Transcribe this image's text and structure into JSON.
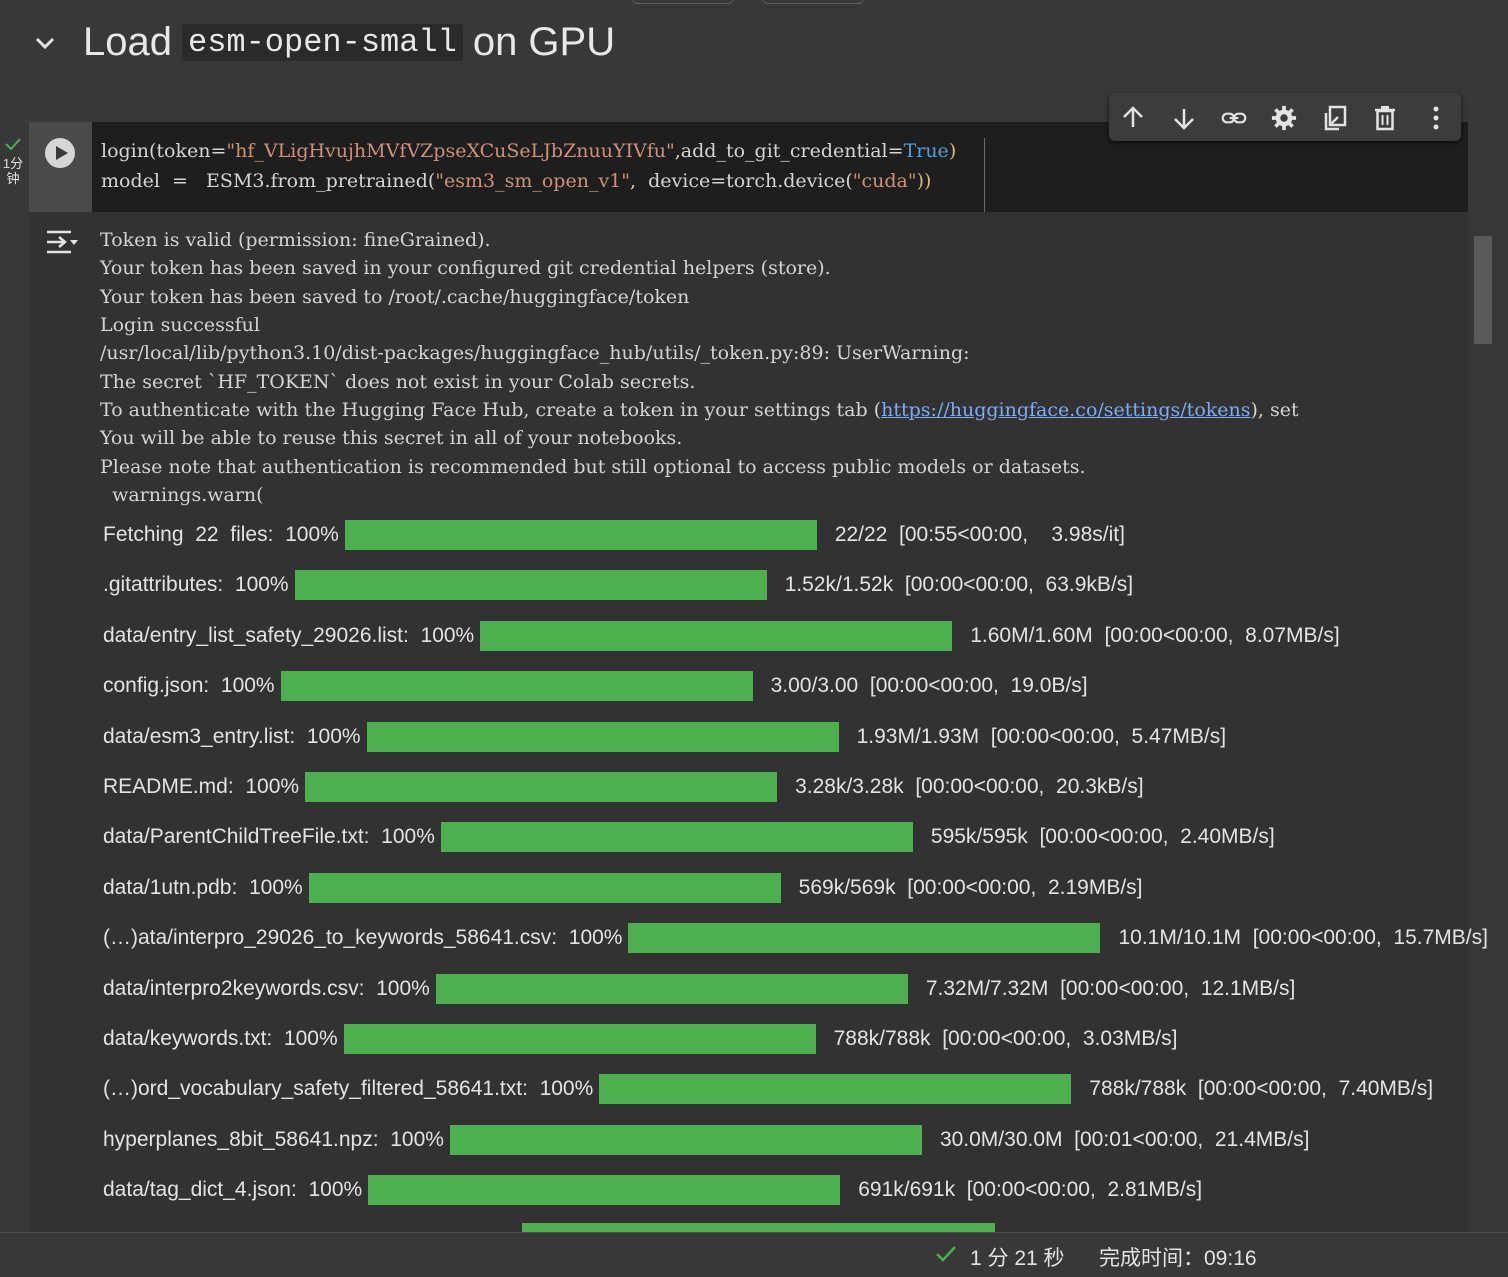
{
  "section": {
    "title_prefix": "Load",
    "title_code": "esm-open-small",
    "title_suffix": "on GPU"
  },
  "cell_status": {
    "time_line1": "1分",
    "time_line2": "钟"
  },
  "code": {
    "line1": {
      "a": "login(token=",
      "b": "\"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\"",
      "c": ",add_to_git_credential=",
      "d": "True",
      "e": ")"
    },
    "line2": {
      "a": "model  =   ESM3.from_pretrained(",
      "b": "\"esm3_sm_open_v1\"",
      "c": ",  device=torch.device(",
      "d": "\"cuda\"",
      "e": "))"
    }
  },
  "toolbar": {
    "icons": [
      "arrow-up-icon",
      "arrow-down-icon",
      "link-icon",
      "gear-icon",
      "mirror-cell-icon",
      "trash-icon",
      "more-vert-icon"
    ]
  },
  "output": {
    "lines": [
      "Token is valid (permission: fineGrained).",
      "Your token has been saved in your configured git credential helpers (store).",
      "Your token has been saved to /root/.cache/huggingface/token",
      "Login successful",
      "/usr/local/lib/python3.10/dist-packages/huggingface_hub/utils/_token.py:89: UserWarning:",
      "The secret `HF_TOKEN` does not exist in your Colab secrets.",
      "To authenticate with the Hugging Face Hub, create a token in your settings tab (",
      "You will be able to reuse this secret in all of your notebooks.",
      "Please note that authentication is recommended but still optional to access public models or datasets.",
      "  warnings.warn("
    ],
    "link_text": "https://huggingface.co/settings/tokens",
    "link_suffix": "), set"
  },
  "progress": [
    {
      "label": "Fetching  22  files:  100%",
      "stats": "22/22  [00:55<00:00,    3.98s/it]",
      "fraction": 1.0
    },
    {
      "label": ".gitattributes:  100%",
      "stats": "1.52k/1.52k  [00:00<00:00,  63.9kB/s]",
      "fraction": 1.0
    },
    {
      "label": "data/entry_list_safety_29026.list:  100%",
      "stats": "1.60M/1.60M  [00:00<00:00,  8.07MB/s]",
      "fraction": 1.0
    },
    {
      "label": "config.json:  100%",
      "stats": "3.00/3.00  [00:00<00:00,  19.0B/s]",
      "fraction": 1.0
    },
    {
      "label": "data/esm3_entry.list:  100%",
      "stats": "1.93M/1.93M  [00:00<00:00,  5.47MB/s]",
      "fraction": 1.0
    },
    {
      "label": "README.md:  100%",
      "stats": "3.28k/3.28k  [00:00<00:00,  20.3kB/s]",
      "fraction": 1.0
    },
    {
      "label": "data/ParentChildTreeFile.txt:  100%",
      "stats": "595k/595k  [00:00<00:00,  2.40MB/s]",
      "fraction": 1.0
    },
    {
      "label": "data/1utn.pdb:  100%",
      "stats": "569k/569k  [00:00<00:00,  2.19MB/s]",
      "fraction": 1.0
    },
    {
      "label": "(…)ata/interpro_29026_to_keywords_58641.csv:  100%",
      "stats": "10.1M/10.1M  [00:00<00:00,  15.7MB/s]",
      "fraction": 1.0
    },
    {
      "label": "data/interpro2keywords.csv:  100%",
      "stats": "7.32M/7.32M  [00:00<00:00,  12.1MB/s]",
      "fraction": 1.0
    },
    {
      "label": "data/keywords.txt:  100%",
      "stats": "788k/788k  [00:00<00:00,  3.03MB/s]",
      "fraction": 1.0
    },
    {
      "label": "(…)ord_vocabulary_safety_filtered_58641.txt:  100%",
      "stats": "788k/788k  [00:00<00:00,  7.40MB/s]",
      "fraction": 1.0
    },
    {
      "label": "hyperplanes_8bit_58641.npz:  100%",
      "stats": "30.0M/30.0M  [00:01<00:00,  21.4MB/s]",
      "fraction": 1.0
    },
    {
      "label": "data/tag_dict_4.json:  100%",
      "stats": "691k/691k  [00:00<00:00,  2.81MB/s]",
      "fraction": 1.0
    }
  ],
  "status_bar": {
    "duration": "1 分 21 秒",
    "completed": "完成时间：09:16"
  },
  "colors": {
    "progress_fill": "#4caf50",
    "status_ok": "#4caf50",
    "string_literal": "#ce9178",
    "keyword": "#569cd6"
  }
}
